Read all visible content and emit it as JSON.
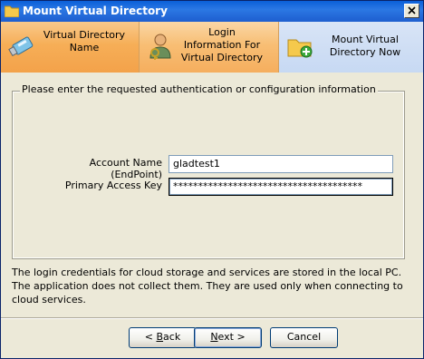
{
  "window": {
    "title": "Mount Virtual Directory"
  },
  "steps": [
    {
      "label_line1": "Virtual Directory",
      "label_line2": "Name",
      "icon": "usb-drive-icon",
      "state": "done"
    },
    {
      "label_line1": "Login",
      "label_line2": "Information For",
      "label_line3": "Virtual Directory",
      "icon": "user-key-icon",
      "state": "active"
    },
    {
      "label_line1": "Mount Virtual",
      "label_line2": "Directory Now",
      "icon": "folder-add-icon",
      "state": "pending"
    }
  ],
  "group": {
    "legend": "Please enter the requested authentication or configuration information"
  },
  "form": {
    "account_label": "Account Name (EndPoint)",
    "account_value": "gladtest1",
    "key_label": "Primary Access Key",
    "key_value": "**************************************"
  },
  "note": "The login credentials for cloud storage and services are stored in the local PC. The application does not collect them. They are used only when connecting to cloud services.",
  "buttons": {
    "back_prefix": "< ",
    "back_mnemonic": "B",
    "back_rest": "ack",
    "next_mnemonic": "N",
    "next_rest": "ext >",
    "cancel": "Cancel"
  },
  "colors": {
    "titlebar": "#0A5FD8",
    "step_orange": "#F6AE57",
    "step_blue": "#C7D9F3",
    "dialog_bg": "#ECE9D8"
  }
}
